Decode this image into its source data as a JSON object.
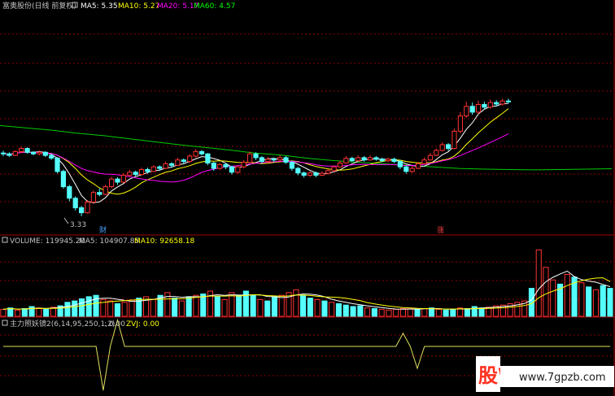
{
  "header": {
    "stock_name": "富奥股份(日线 前复权)",
    "ma": [
      {
        "label": "MA5: 5.35",
        "color": "#ffffff"
      },
      {
        "label": "MA10: 5.27",
        "color": "#ffff00"
      },
      {
        "label": "MA20: 5.17",
        "color": "#ff00ff"
      },
      {
        "label": "MA60: 4.57",
        "color": "#00ff00"
      }
    ]
  },
  "annotations": {
    "low_price": "3.33",
    "marker_cai": "财",
    "marker_zhang": "涨"
  },
  "volume_header": {
    "volume": "VOLUME: 119945.20",
    "ma5": "MA5: 104907.85",
    "ma10": "MA10: 92658.18"
  },
  "indicator_header": {
    "name": "主力照妖镜2(6,14,95,250,1,2)",
    "value": ": 0.00",
    "zvj": "ZVJ: 0.00"
  },
  "watermark": {
    "logo": "股W",
    "url": "www.7gpzb.com"
  },
  "colors": {
    "up": "#ff3232",
    "down": "#54ffff",
    "ma5": "#ffffff",
    "ma10": "#ffff00",
    "ma20": "#ff00ff",
    "ma60": "#00cc00",
    "grid": "#8b0000",
    "indicator": "#e0e060"
  },
  "chart_data": [
    {
      "type": "candlestick",
      "title": "富奥股份(日线 前复权)",
      "price_range": [
        3.2,
        6.6
      ],
      "candles": [
        [
          4.98,
          4.97,
          5.04,
          4.9
        ],
        [
          4.96,
          4.92,
          5.0,
          4.88
        ],
        [
          4.92,
          5.02,
          5.05,
          4.9
        ],
        [
          5.02,
          5.1,
          5.14,
          4.98
        ],
        [
          5.1,
          5.0,
          5.13,
          4.96
        ],
        [
          5.0,
          4.96,
          5.03,
          4.92
        ],
        [
          4.96,
          5.0,
          5.05,
          4.92
        ],
        [
          5.0,
          4.92,
          5.03,
          4.88
        ],
        [
          4.92,
          4.85,
          4.96,
          4.8
        ],
        [
          4.85,
          4.5,
          4.87,
          4.45
        ],
        [
          4.5,
          4.1,
          4.55,
          4.05
        ],
        [
          4.1,
          3.8,
          4.15,
          3.72
        ],
        [
          3.8,
          3.55,
          3.85,
          3.48
        ],
        [
          3.55,
          3.42,
          3.6,
          3.33
        ],
        [
          3.42,
          3.7,
          3.75,
          3.4
        ],
        [
          3.7,
          3.95,
          4.0,
          3.65
        ],
        [
          3.95,
          3.9,
          4.05,
          3.85
        ],
        [
          3.9,
          4.1,
          4.15,
          3.88
        ],
        [
          4.1,
          4.3,
          4.36,
          4.06
        ],
        [
          4.3,
          4.22,
          4.35,
          4.15
        ],
        [
          4.22,
          4.4,
          4.46,
          4.2
        ],
        [
          4.4,
          4.48,
          4.54,
          4.36
        ],
        [
          4.48,
          4.42,
          4.52,
          4.38
        ],
        [
          4.42,
          4.55,
          4.6,
          4.4
        ],
        [
          4.55,
          4.5,
          4.6,
          4.44
        ],
        [
          4.5,
          4.62,
          4.66,
          4.48
        ],
        [
          4.62,
          4.58,
          4.66,
          4.52
        ],
        [
          4.58,
          4.7,
          4.76,
          4.56
        ],
        [
          4.7,
          4.66,
          4.74,
          4.6
        ],
        [
          4.66,
          4.8,
          4.86,
          4.64
        ],
        [
          4.8,
          4.76,
          4.84,
          4.7
        ],
        [
          4.76,
          4.9,
          4.95,
          4.72
        ],
        [
          4.9,
          5.02,
          5.08,
          4.86
        ],
        [
          5.02,
          4.96,
          5.06,
          4.92
        ],
        [
          4.96,
          4.72,
          4.98,
          4.66
        ],
        [
          4.72,
          4.58,
          4.75,
          4.52
        ],
        [
          4.58,
          4.68,
          4.72,
          4.54
        ],
        [
          4.68,
          4.62,
          4.72,
          4.56
        ],
        [
          4.62,
          4.48,
          4.65,
          4.42
        ],
        [
          4.48,
          4.62,
          4.66,
          4.44
        ],
        [
          4.62,
          4.74,
          4.8,
          4.58
        ],
        [
          4.74,
          4.96,
          5.02,
          4.72
        ],
        [
          4.96,
          4.86,
          5.0,
          4.8
        ],
        [
          4.86,
          4.76,
          4.9,
          4.7
        ],
        [
          4.76,
          4.82,
          4.88,
          4.72
        ],
        [
          4.82,
          4.8,
          4.86,
          4.74
        ],
        [
          4.8,
          4.86,
          4.92,
          4.76
        ],
        [
          4.86,
          4.74,
          4.9,
          4.7
        ],
        [
          4.74,
          4.58,
          4.78,
          4.52
        ],
        [
          4.58,
          4.46,
          4.62,
          4.4
        ],
        [
          4.46,
          4.4,
          4.5,
          4.34
        ],
        [
          4.4,
          4.46,
          4.5,
          4.36
        ],
        [
          4.46,
          4.4,
          4.5,
          4.35
        ],
        [
          4.4,
          4.45,
          4.5,
          4.38
        ],
        [
          4.45,
          4.52,
          4.56,
          4.42
        ],
        [
          4.52,
          4.62,
          4.66,
          4.48
        ],
        [
          4.62,
          4.72,
          4.78,
          4.6
        ],
        [
          4.72,
          4.84,
          4.9,
          4.7
        ],
        [
          4.84,
          4.78,
          4.88,
          4.74
        ],
        [
          4.78,
          4.86,
          4.92,
          4.76
        ],
        [
          4.86,
          4.8,
          4.9,
          4.76
        ],
        [
          4.8,
          4.86,
          4.92,
          4.78
        ],
        [
          4.86,
          4.82,
          4.9,
          4.78
        ],
        [
          4.82,
          4.78,
          4.86,
          4.74
        ],
        [
          4.78,
          4.82,
          4.86,
          4.74
        ],
        [
          4.82,
          4.76,
          4.86,
          4.72
        ],
        [
          4.76,
          4.62,
          4.8,
          4.56
        ],
        [
          4.62,
          4.5,
          4.66,
          4.44
        ],
        [
          4.5,
          4.58,
          4.64,
          4.46
        ],
        [
          4.58,
          4.7,
          4.74,
          4.56
        ],
        [
          4.7,
          4.8,
          4.86,
          4.68
        ],
        [
          4.8,
          4.92,
          4.98,
          4.78
        ],
        [
          4.92,
          5.05,
          5.1,
          4.9
        ],
        [
          5.05,
          5.2,
          5.26,
          5.02
        ],
        [
          5.2,
          5.1,
          5.24,
          5.04
        ],
        [
          5.1,
          5.55,
          5.62,
          5.08
        ],
        [
          5.55,
          5.95,
          6.05,
          5.5
        ],
        [
          5.95,
          6.2,
          6.32,
          5.9
        ],
        [
          6.2,
          6.05,
          6.3,
          5.98
        ],
        [
          6.05,
          6.25,
          6.35,
          6.0
        ],
        [
          6.25,
          6.18,
          6.32,
          6.12
        ],
        [
          6.18,
          6.3,
          6.38,
          6.14
        ],
        [
          6.3,
          6.26,
          6.36,
          6.2
        ],
        [
          6.26,
          6.34,
          6.4,
          6.22
        ],
        [
          6.34,
          6.32,
          6.4,
          6.28
        ]
      ],
      "ma60": [
        5.7,
        5.64,
        5.58,
        5.5,
        5.44,
        5.36,
        5.28,
        5.2,
        5.13,
        5.06,
        4.98,
        4.93,
        4.85,
        4.79,
        4.74,
        4.7,
        4.66,
        4.62,
        4.58,
        4.56,
        4.55,
        4.54,
        4.55,
        4.56,
        4.57
      ]
    },
    {
      "type": "bar",
      "title": "VOLUME",
      "ylim": [
        0,
        1.0
      ],
      "up_down": [
        0,
        1,
        0,
        1,
        1,
        0,
        1,
        0,
        1,
        1,
        1,
        1,
        1,
        1,
        0,
        0,
        1,
        0,
        0,
        1,
        0,
        0,
        1,
        0,
        1,
        0,
        1,
        0,
        1,
        0,
        1,
        0,
        0,
        1,
        1,
        1,
        0,
        1,
        1,
        0,
        0,
        0,
        1,
        1,
        0,
        1,
        0,
        1,
        1,
        1,
        1,
        0,
        1,
        0,
        0,
        0,
        0,
        0,
        1,
        0,
        1,
        0,
        1,
        1,
        0,
        1,
        1,
        1,
        0,
        0,
        0,
        0,
        0,
        0,
        1,
        0,
        0,
        0,
        1,
        0,
        1,
        0,
        1,
        0,
        1,
        1
      ],
      "values": [
        0.1,
        0.12,
        0.09,
        0.11,
        0.14,
        0.12,
        0.1,
        0.13,
        0.15,
        0.2,
        0.22,
        0.25,
        0.28,
        0.3,
        0.24,
        0.22,
        0.18,
        0.2,
        0.23,
        0.26,
        0.28,
        0.24,
        0.3,
        0.34,
        0.26,
        0.22,
        0.28,
        0.3,
        0.32,
        0.36,
        0.28,
        0.24,
        0.34,
        0.3,
        0.36,
        0.3,
        0.24,
        0.22,
        0.28,
        0.3,
        0.34,
        0.38,
        0.3,
        0.26,
        0.24,
        0.22,
        0.2,
        0.18,
        0.16,
        0.14,
        0.15,
        0.12,
        0.11,
        0.1,
        0.09,
        0.1,
        0.11,
        0.12,
        0.1,
        0.11,
        0.12,
        0.1,
        0.09,
        0.1,
        0.12,
        0.11,
        0.14,
        0.12,
        0.13,
        0.15,
        0.16,
        0.18,
        0.2,
        0.22,
        0.4,
        0.95,
        0.7,
        0.52,
        0.46,
        0.6,
        0.56,
        0.48,
        0.42,
        0.38,
        0.44,
        0.4
      ]
    },
    {
      "type": "line",
      "title": "主力照妖镜2(6,14,95,250,1,2)",
      "ylim": [
        -1,
        1
      ],
      "values": [
        0,
        0,
        0,
        0,
        0,
        0,
        0,
        0,
        0,
        0,
        0,
        0,
        0,
        0,
        -1,
        0,
        0.6,
        0,
        0,
        0,
        0,
        0,
        0,
        0,
        0,
        0,
        0,
        0,
        0,
        0,
        0,
        0,
        0,
        0,
        0,
        0,
        0,
        0,
        0,
        0,
        0,
        0,
        0,
        0,
        0,
        0,
        0,
        0,
        0,
        0,
        0,
        0,
        0,
        0,
        0,
        0,
        0.3,
        0,
        -0.5,
        0,
        0,
        0,
        0,
        0,
        0,
        0,
        0,
        0,
        0,
        0,
        0,
        0,
        0,
        0,
        0,
        0,
        0,
        0,
        0,
        0,
        0,
        0,
        0,
        0,
        0,
        0
      ]
    }
  ]
}
